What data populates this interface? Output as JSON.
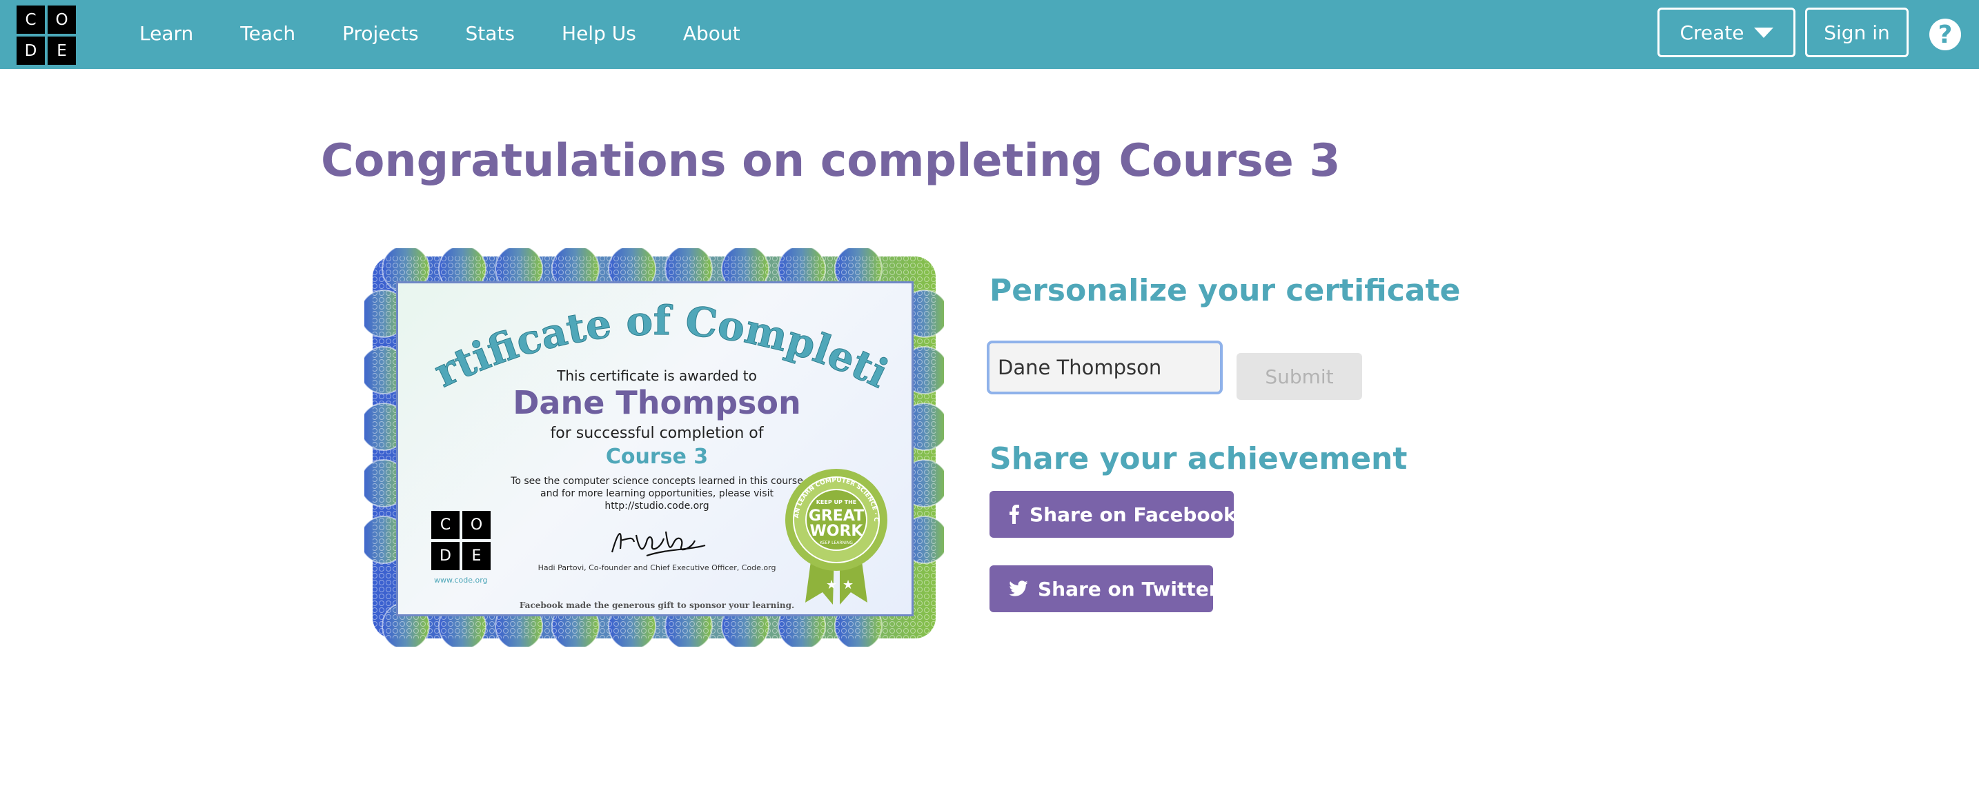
{
  "header": {
    "logo_letters": [
      "C",
      "O",
      "D",
      "E"
    ],
    "nav": [
      "Learn",
      "Teach",
      "Projects",
      "Stats",
      "Help Us",
      "About"
    ],
    "create_label": "Create",
    "signin_label": "Sign in",
    "help_label": "?"
  },
  "main": {
    "title": "Congratulations on completing Course 3"
  },
  "certificate": {
    "heading": "Certificate of Completion",
    "awarded_to": "This certificate is awarded to",
    "name": "Dane Thompson",
    "completion_text": "for successful completion of",
    "course": "Course 3",
    "note_line1": "To see the computer science concepts learned in this course",
    "note_line2": "and for more learning opportunities, please visit",
    "note_url": "http://studio.code.org",
    "logo_letters": [
      "C",
      "O",
      "D",
      "E"
    ],
    "logo_url": "www.code.org",
    "signature": "Hadi Partovi",
    "signer_line": "Hadi Partovi, Co-founder and Chief Executive Officer, Code.org",
    "seal_ring_text": "ANYONE CAN LEARN COMPUTER SCIENCE · CODE.ORG",
    "seal_top": "KEEP UP THE",
    "seal_main1": "GREAT",
    "seal_main2": "WORK",
    "seal_bottom": "KEEP LEARNING",
    "footer": "Facebook made the generous gift to sponsor your learning."
  },
  "personalize": {
    "title": "Personalize your certificate",
    "name_value": "Dane Thompson",
    "submit_label": "Submit"
  },
  "share": {
    "title": "Share your achievement",
    "facebook_label": "Share on Facebook",
    "twitter_label": "Share on Twitter"
  },
  "colors": {
    "header_bg": "#4ba9ba",
    "title_purple": "#7665a0",
    "section_teal": "#4fa7b9",
    "share_purple": "#7a63a9"
  }
}
